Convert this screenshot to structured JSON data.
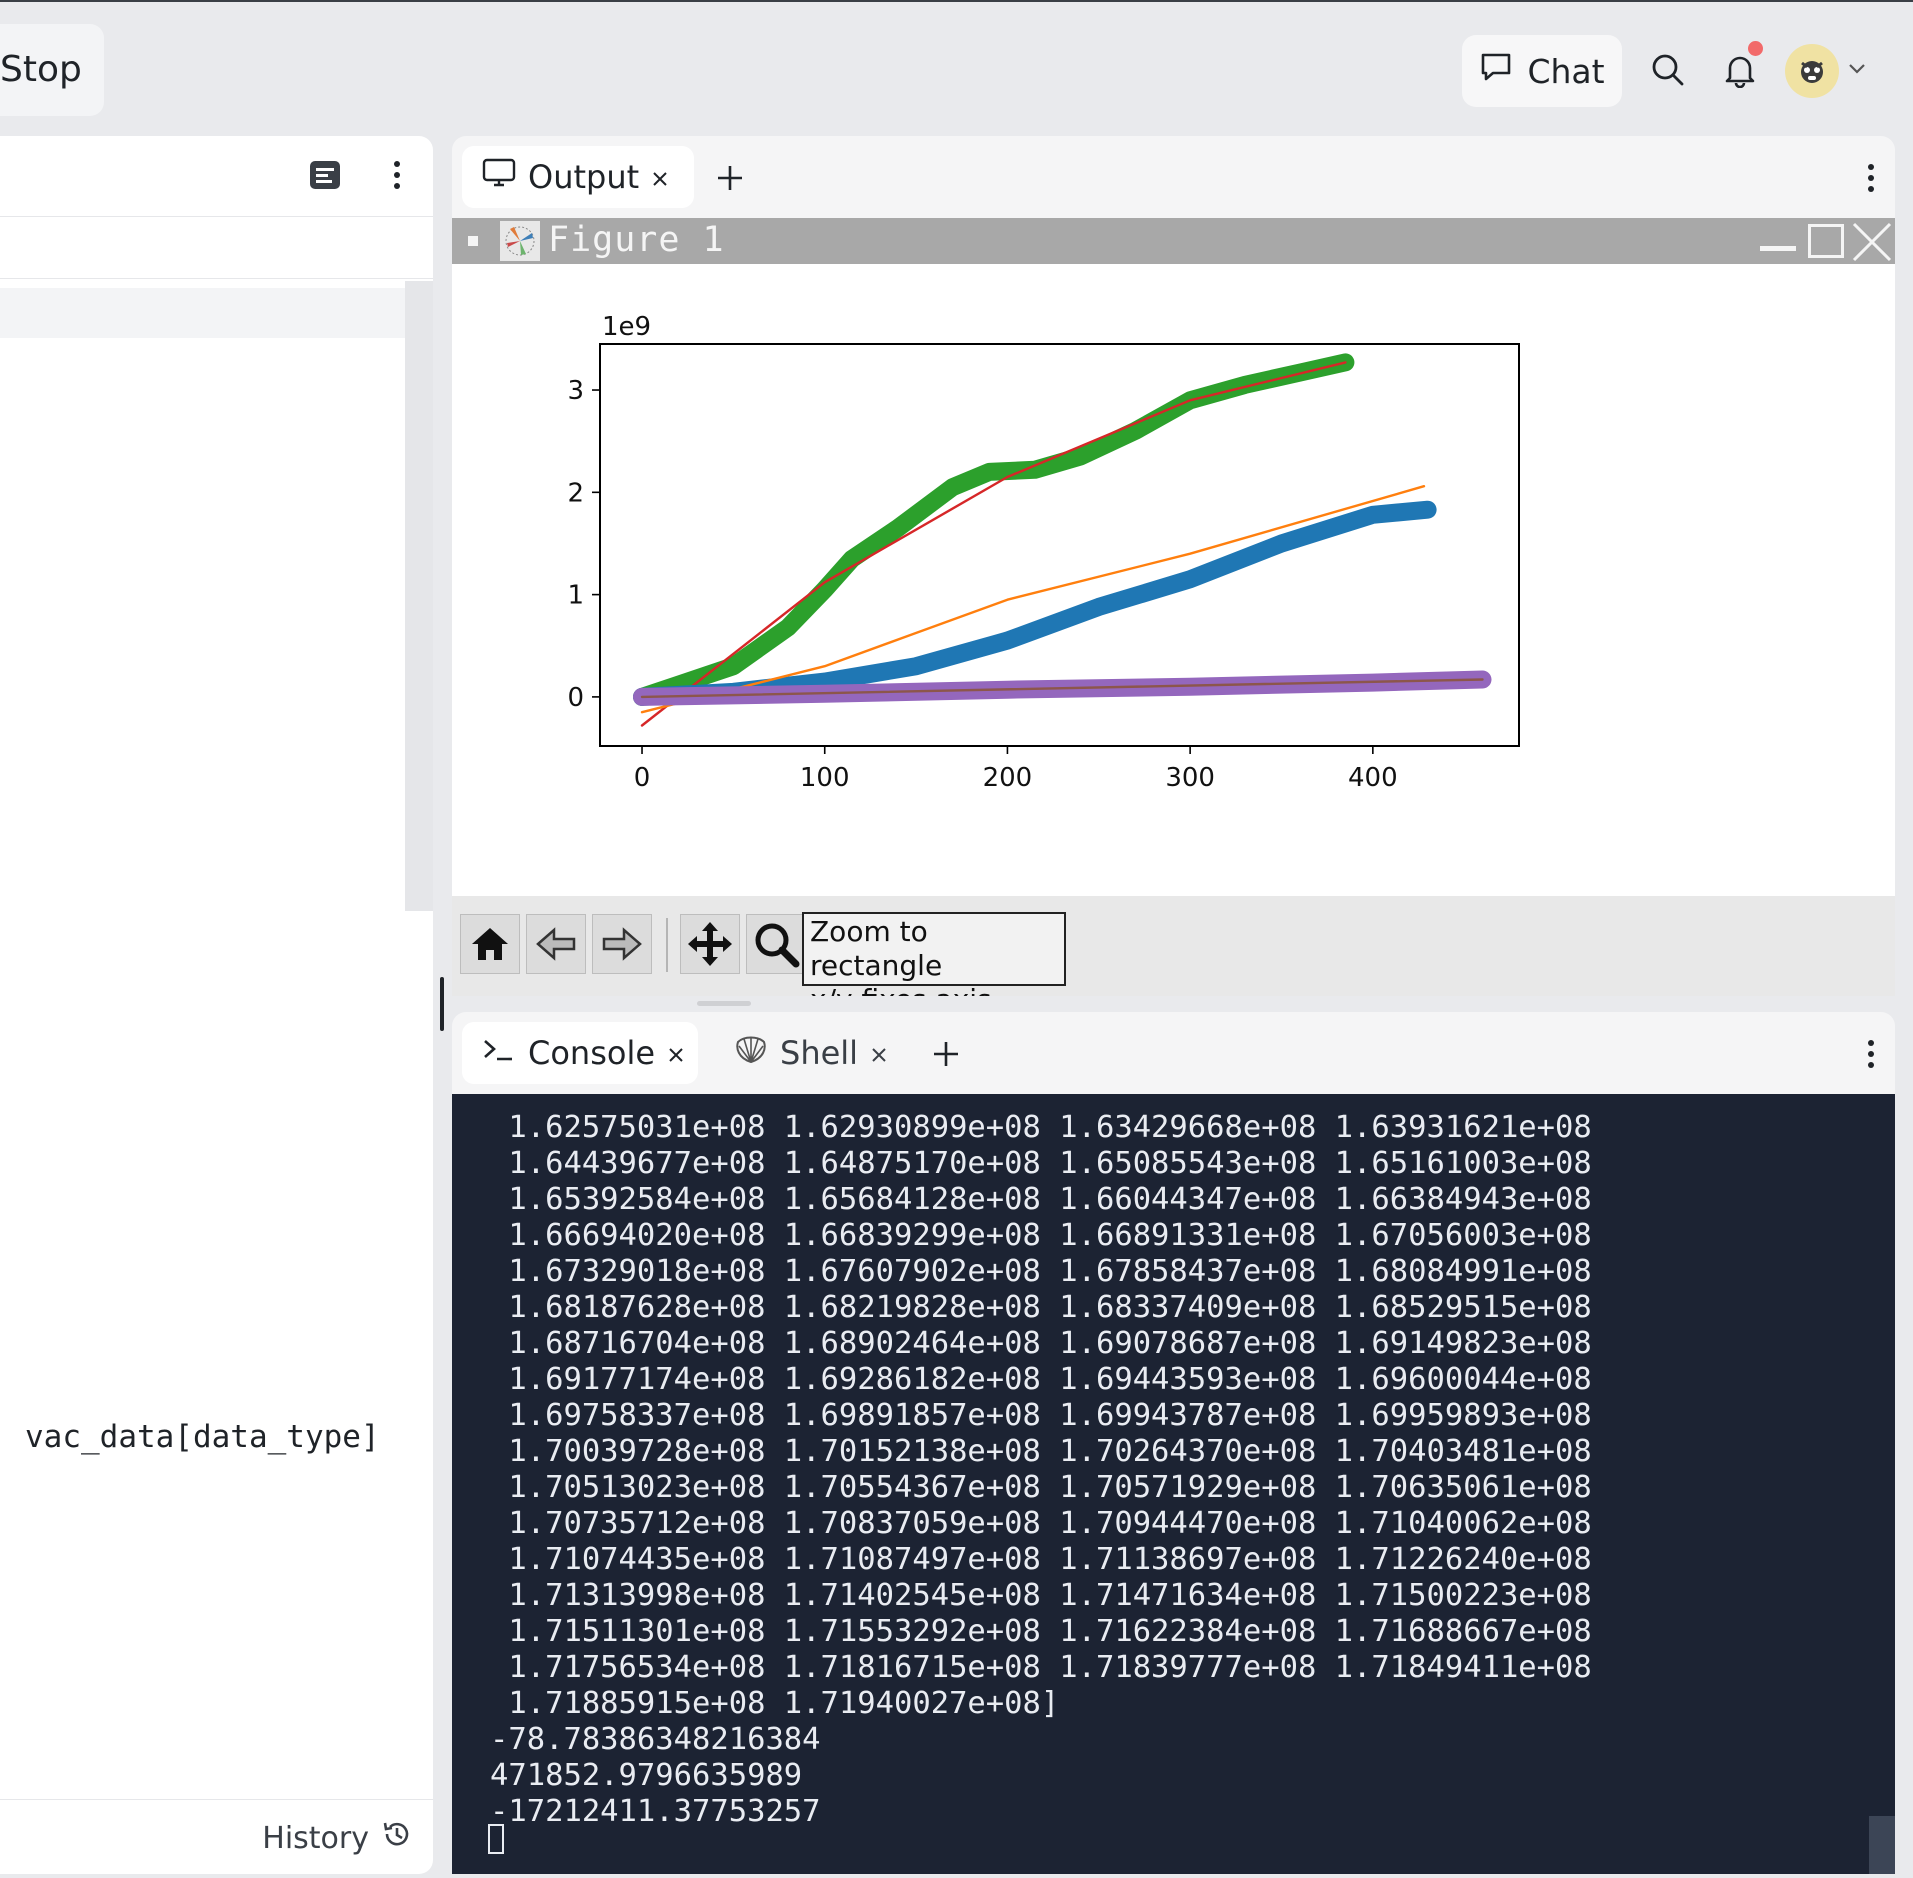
{
  "topbar": {
    "stop_label": "Stop",
    "chat_label": "Chat"
  },
  "left_pane": {
    "code_text": "vac_data[data_type]",
    "history_label": "History"
  },
  "output_pane": {
    "tabs": [
      {
        "label": "Output"
      }
    ],
    "figure_title": "Figure 1",
    "toolbar_tooltip_line1": "Zoom to rectangle",
    "toolbar_tooltip_line2": "x/y fixes axis"
  },
  "chart_data": {
    "type": "line",
    "title": "",
    "xlabel": "",
    "ylabel": "",
    "y_offset_text": "1e9",
    "xlim": [
      -23,
      480
    ],
    "ylim": [
      -0.48,
      3.45
    ],
    "xticks": [
      0,
      100,
      200,
      300,
      400
    ],
    "xtick_labels": [
      "0",
      "100",
      "200",
      "300",
      "400"
    ],
    "yticks": [
      0,
      1,
      2,
      3
    ],
    "ytick_labels": [
      "0",
      "1",
      "2",
      "3"
    ],
    "grid": false,
    "legend": "none",
    "series": [
      {
        "color": "#2ca02c",
        "style": "thick",
        "x": [
          0,
          20,
          50,
          80,
          100,
          115,
          140,
          170,
          190,
          215,
          240,
          270,
          300,
          330,
          360,
          385
        ],
        "y": [
          0,
          0.12,
          0.3,
          0.68,
          1.05,
          1.35,
          1.65,
          2.05,
          2.2,
          2.22,
          2.35,
          2.6,
          2.9,
          3.05,
          3.17,
          3.27
        ]
      },
      {
        "color": "#d62728",
        "style": "thin",
        "x": [
          0,
          100,
          200,
          300,
          385
        ],
        "y": [
          -0.28,
          1.12,
          2.15,
          2.9,
          3.27
        ]
      },
      {
        "color": "#1f77b4",
        "style": "thick",
        "x": [
          0,
          50,
          100,
          150,
          200,
          250,
          300,
          350,
          400,
          430
        ],
        "y": [
          0,
          0.05,
          0.15,
          0.3,
          0.55,
          0.88,
          1.15,
          1.5,
          1.78,
          1.83
        ]
      },
      {
        "color": "#ff7f0e",
        "style": "thin",
        "x": [
          0,
          100,
          200,
          300,
          428
        ],
        "y": [
          -0.15,
          0.3,
          0.95,
          1.4,
          2.06
        ]
      },
      {
        "color": "#9467bd",
        "style": "thick",
        "x": [
          0,
          100,
          200,
          300,
          400,
          460
        ],
        "y": [
          0,
          0.03,
          0.07,
          0.1,
          0.14,
          0.17
        ]
      },
      {
        "color": "#8c564b",
        "style": "thin",
        "x": [
          0,
          460
        ],
        "y": [
          0,
          0.17
        ]
      }
    ]
  },
  "console_pane": {
    "tabs": [
      {
        "label": "Console"
      },
      {
        "label": "Shell"
      }
    ],
    "lines": [
      " 1.62575031e+08 1.62930899e+08 1.63429668e+08 1.63931621e+08",
      " 1.64439677e+08 1.64875170e+08 1.65085543e+08 1.65161003e+08",
      " 1.65392584e+08 1.65684128e+08 1.66044347e+08 1.66384943e+08",
      " 1.66694020e+08 1.66839299e+08 1.66891331e+08 1.67056003e+08",
      " 1.67329018e+08 1.67607902e+08 1.67858437e+08 1.68084991e+08",
      " 1.68187628e+08 1.68219828e+08 1.68337409e+08 1.68529515e+08",
      " 1.68716704e+08 1.68902464e+08 1.69078687e+08 1.69149823e+08",
      " 1.69177174e+08 1.69286182e+08 1.69443593e+08 1.69600044e+08",
      " 1.69758337e+08 1.69891857e+08 1.69943787e+08 1.69959893e+08",
      " 1.70039728e+08 1.70152138e+08 1.70264370e+08 1.70403481e+08",
      " 1.70513023e+08 1.70554367e+08 1.70571929e+08 1.70635061e+08",
      " 1.70735712e+08 1.70837059e+08 1.70944470e+08 1.71040062e+08",
      " 1.71074435e+08 1.71087497e+08 1.71138697e+08 1.71226240e+08",
      " 1.71313998e+08 1.71402545e+08 1.71471634e+08 1.71500223e+08",
      " 1.71511301e+08 1.71553292e+08 1.71622384e+08 1.71688667e+08",
      " 1.71756534e+08 1.71816715e+08 1.71839777e+08 1.71849411e+08",
      " 1.71885915e+08 1.71940027e+08]",
      "-78.78386348216384",
      "471852.9796635989",
      "-17212411.37753257"
    ]
  }
}
